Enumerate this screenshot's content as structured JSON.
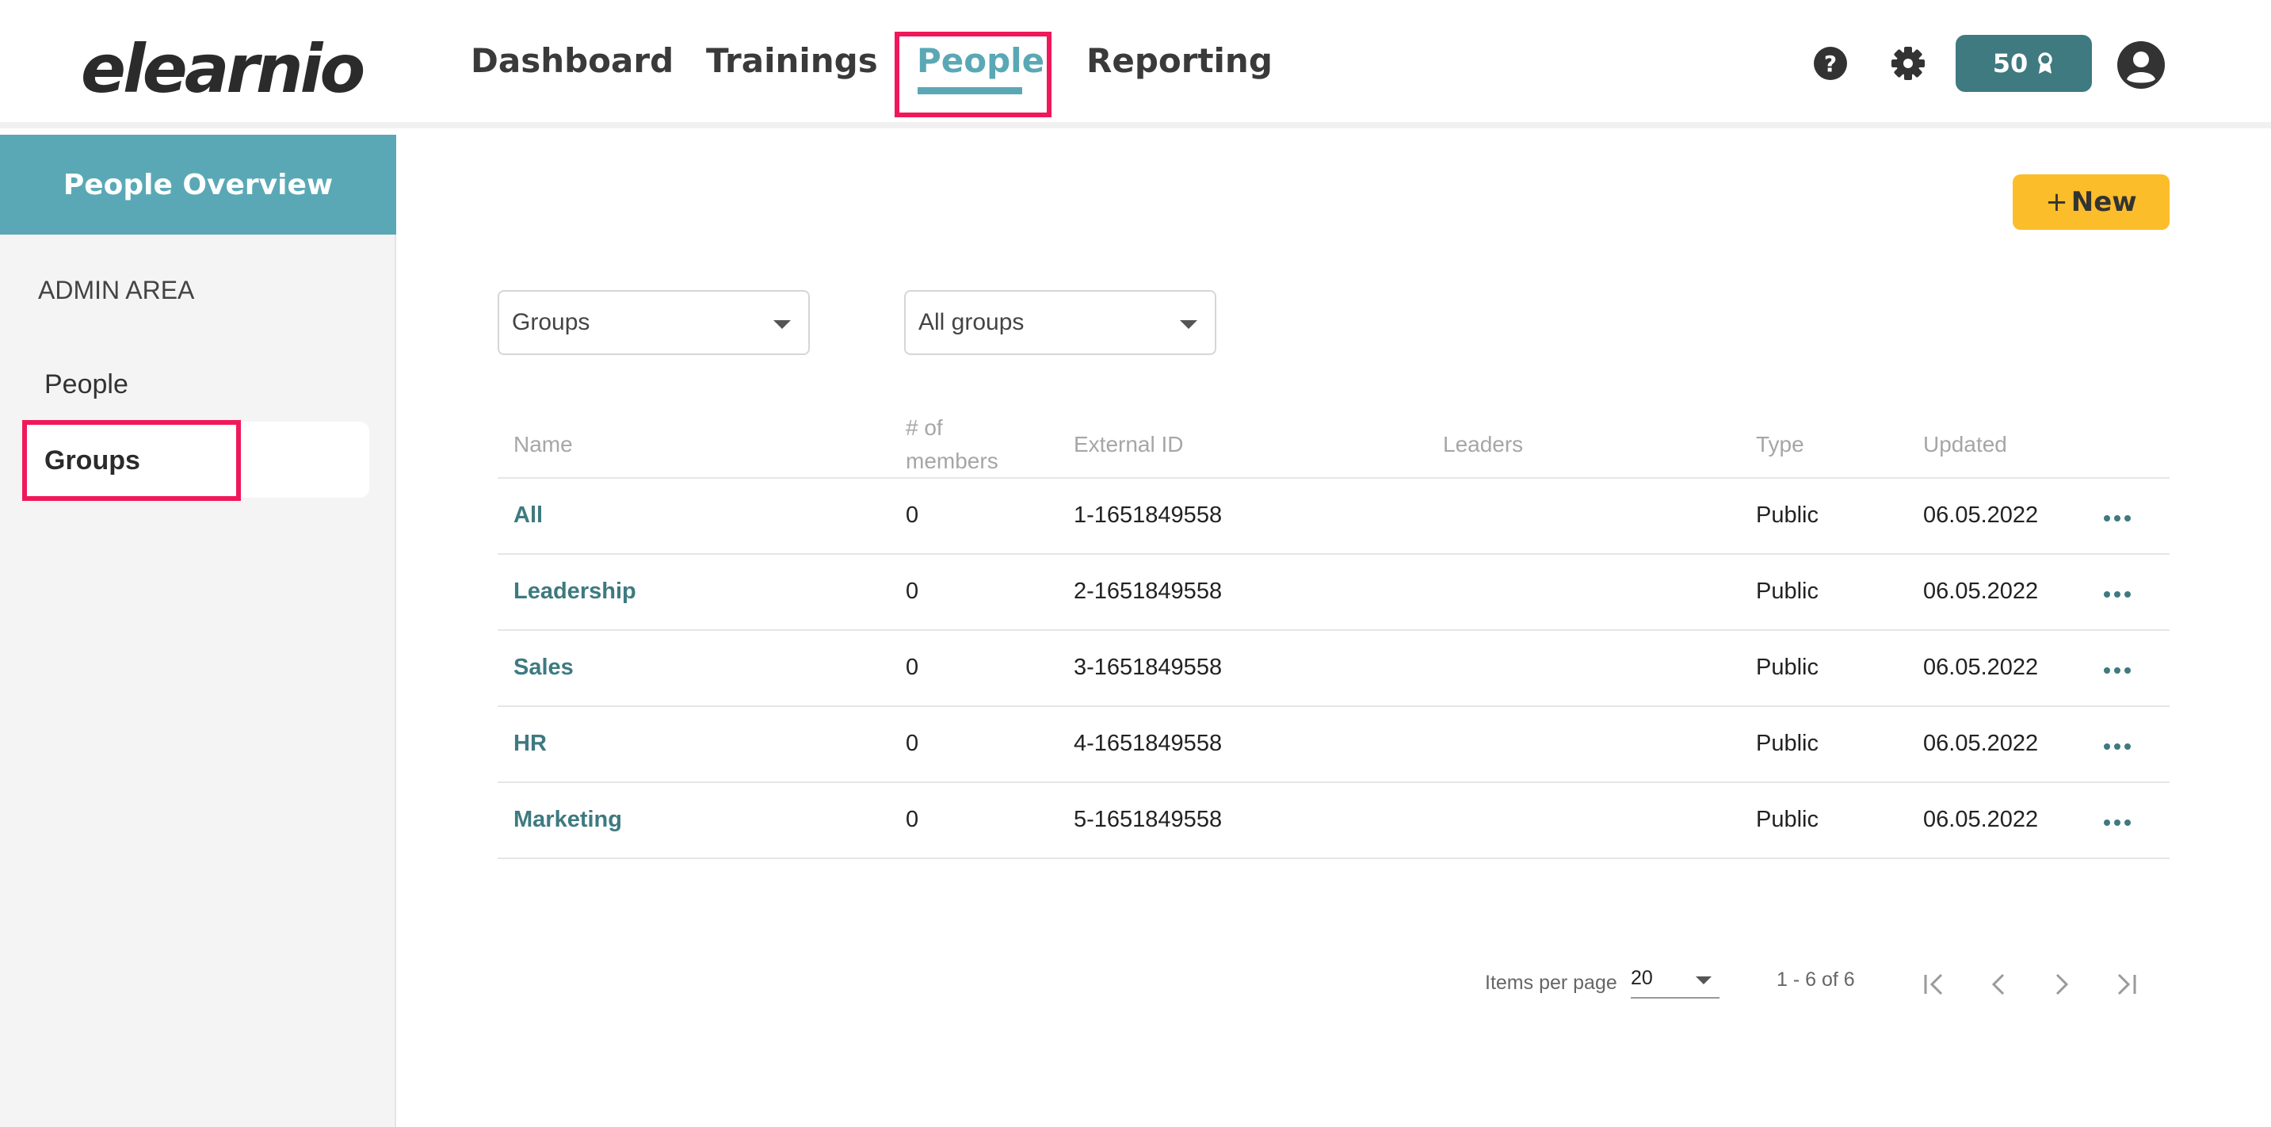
{
  "app": {
    "logo": "elearnio"
  },
  "nav": {
    "items": [
      {
        "label": "Dashboard"
      },
      {
        "label": "Trainings"
      },
      {
        "label": "People"
      },
      {
        "label": "Reporting"
      }
    ],
    "active": "People"
  },
  "header": {
    "points": "50",
    "help_icon": "help-icon",
    "settings_icon": "gear-icon",
    "avatar_icon": "user-avatar-icon"
  },
  "sidebar": {
    "title": "People Overview",
    "section": "ADMIN AREA",
    "items": [
      {
        "label": "People"
      },
      {
        "label": "Groups"
      }
    ]
  },
  "toolbar": {
    "new_label": "New"
  },
  "filters": {
    "type": "Groups",
    "scope": "All groups"
  },
  "table": {
    "headers": {
      "name": "Name",
      "members_line1": "# of",
      "members_line2": "members",
      "external_id": "External ID",
      "leaders": "Leaders",
      "type": "Type",
      "updated": "Updated"
    },
    "rows": [
      {
        "name": "All",
        "members": "0",
        "external_id": "1-1651849558",
        "leaders": "",
        "type": "Public",
        "updated": "06.05.2022"
      },
      {
        "name": "Leadership",
        "members": "0",
        "external_id": "2-1651849558",
        "leaders": "",
        "type": "Public",
        "updated": "06.05.2022"
      },
      {
        "name": "Sales",
        "members": "0",
        "external_id": "3-1651849558",
        "leaders": "",
        "type": "Public",
        "updated": "06.05.2022"
      },
      {
        "name": "HR",
        "members": "0",
        "external_id": "4-1651849558",
        "leaders": "",
        "type": "Public",
        "updated": "06.05.2022"
      },
      {
        "name": "Marketing",
        "members": "0",
        "external_id": "5-1651849558",
        "leaders": "",
        "type": "Public",
        "updated": "06.05.2022"
      }
    ]
  },
  "pagination": {
    "items_per_page_label": "Items per page",
    "items_per_page": "20",
    "range": "1 - 6 of 6"
  },
  "colors": {
    "accent": "#5aa8b5",
    "primary_dark": "#3e7a80",
    "new_button": "#fbbd2a",
    "highlight": "#f0185a"
  }
}
